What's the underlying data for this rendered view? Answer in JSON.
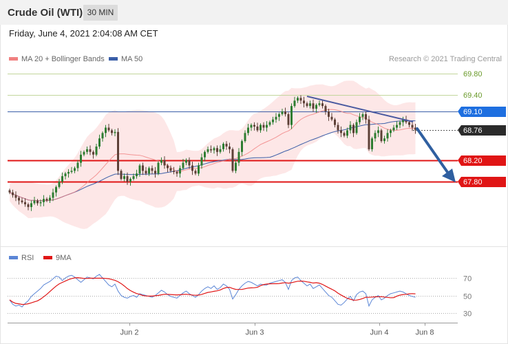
{
  "header": {
    "title": "Crude Oil (WTI)",
    "interval": "30 MIN",
    "datetime": "Friday, June 4, 2021 2:04:08 AM CET"
  },
  "legend": {
    "ma20": "MA 20 + Bollinger Bands",
    "ma50": "MA 50",
    "rsi": "RSI",
    "ma9": "9MA",
    "credit": "Research © 2021 Trading Central"
  },
  "colors": {
    "up": "#2e7d32",
    "down": "#5d4037",
    "band": "#fde7e7",
    "ma20": "#f08080",
    "ma50": "#3a5ea8",
    "resistance_thin": "#c2d69b",
    "pivot_line": "#3a5ea8",
    "support": "#e01515",
    "rsi": "#5b86d6",
    "ma9": "#e01515",
    "arrow": "#2f5fa0"
  },
  "chart_data": [
    {
      "type": "candlestick",
      "title": "Crude Oil (WTI)",
      "interval": "30 MIN",
      "ylim": [
        67.3,
        70.0
      ],
      "x_ticks": [
        "Jun 2",
        "Jun 3",
        "Jun 4",
        "Jun 8"
      ],
      "levels": [
        {
          "value": 69.8,
          "label": "69.80",
          "kind": "resistance",
          "color": "#6a9a2a"
        },
        {
          "value": 69.4,
          "label": "69.40",
          "kind": "resistance",
          "color": "#6a9a2a"
        },
        {
          "value": 69.1,
          "label": "69.10",
          "kind": "pivot",
          "color": "#1e6fe0"
        },
        {
          "value": 68.76,
          "label": "68.76",
          "kind": "last",
          "color": "#2b2b2b"
        },
        {
          "value": 68.2,
          "label": "68.20",
          "kind": "support",
          "color": "#e01515"
        },
        {
          "value": 67.8,
          "label": "67.80",
          "kind": "support",
          "color": "#e01515"
        }
      ],
      "close": [
        67.6,
        67.55,
        67.5,
        67.45,
        67.42,
        67.38,
        67.33,
        67.4,
        67.45,
        67.4,
        67.42,
        67.48,
        67.45,
        67.5,
        67.6,
        67.7,
        67.8,
        67.9,
        67.95,
        67.98,
        68.0,
        68.05,
        68.15,
        68.3,
        68.35,
        68.4,
        68.35,
        68.3,
        68.45,
        68.6,
        68.7,
        68.8,
        68.75,
        68.7,
        68.72,
        68.0,
        67.85,
        67.9,
        67.8,
        67.85,
        67.9,
        67.95,
        68.1,
        68.0,
        67.95,
        68.05,
        68.0,
        67.95,
        68.15,
        68.2,
        68.1,
        68.05,
        68.0,
        67.98,
        67.95,
        68.05,
        68.15,
        68.2,
        68.1,
        68.0,
        67.95,
        68.1,
        68.25,
        68.35,
        68.4,
        68.38,
        68.42,
        68.35,
        68.4,
        68.5,
        68.45,
        68.4,
        68.0,
        68.15,
        68.35,
        68.55,
        68.7,
        68.8,
        68.85,
        68.82,
        68.75,
        68.85,
        68.8,
        68.85,
        68.9,
        68.95,
        69.0,
        69.05,
        69.1,
        69.05,
        68.85,
        69.2,
        69.3,
        69.35,
        69.3,
        69.25,
        69.2,
        69.25,
        69.15,
        69.22,
        69.25,
        69.2,
        69.1,
        69.0,
        68.95,
        68.85,
        68.75,
        68.7,
        68.65,
        68.75,
        68.85,
        68.7,
        68.9,
        69.0,
        69.05,
        68.95,
        68.4,
        68.6,
        68.7,
        68.75,
        68.55,
        68.6,
        68.7,
        68.75,
        68.8,
        68.85,
        68.9,
        68.95,
        68.9,
        68.85,
        68.8,
        68.76
      ],
      "rsi": [
        45,
        40,
        38,
        39,
        37,
        41,
        44,
        49,
        52,
        55,
        58,
        62,
        64,
        66,
        69,
        72,
        71,
        67,
        70,
        72,
        73,
        71,
        68,
        65,
        68,
        71,
        70,
        69,
        72,
        74,
        70,
        66,
        62,
        60,
        63,
        55,
        50,
        48,
        47,
        49,
        50,
        48,
        52,
        51,
        50,
        49,
        48,
        50,
        53,
        56,
        54,
        51,
        49,
        48,
        47,
        50,
        53,
        55,
        52,
        50,
        48,
        51,
        55,
        58,
        60,
        58,
        61,
        57,
        59,
        63,
        61,
        57,
        46,
        51,
        57,
        61,
        64,
        66,
        65,
        63,
        61,
        63,
        62,
        62,
        64,
        65,
        66,
        67,
        68,
        65,
        57,
        67,
        70,
        71,
        67,
        64,
        61,
        63,
        58,
        60,
        62,
        58,
        54,
        50,
        48,
        44,
        40,
        39,
        42,
        46,
        49,
        44,
        51,
        54,
        55,
        52,
        38,
        45,
        48,
        50,
        45,
        47,
        50,
        52,
        53,
        54,
        55,
        54,
        52,
        50,
        49,
        48
      ],
      "rsi_ticks": [
        70,
        50,
        30
      ],
      "rsi_ylim": [
        20,
        80
      ]
    }
  ]
}
